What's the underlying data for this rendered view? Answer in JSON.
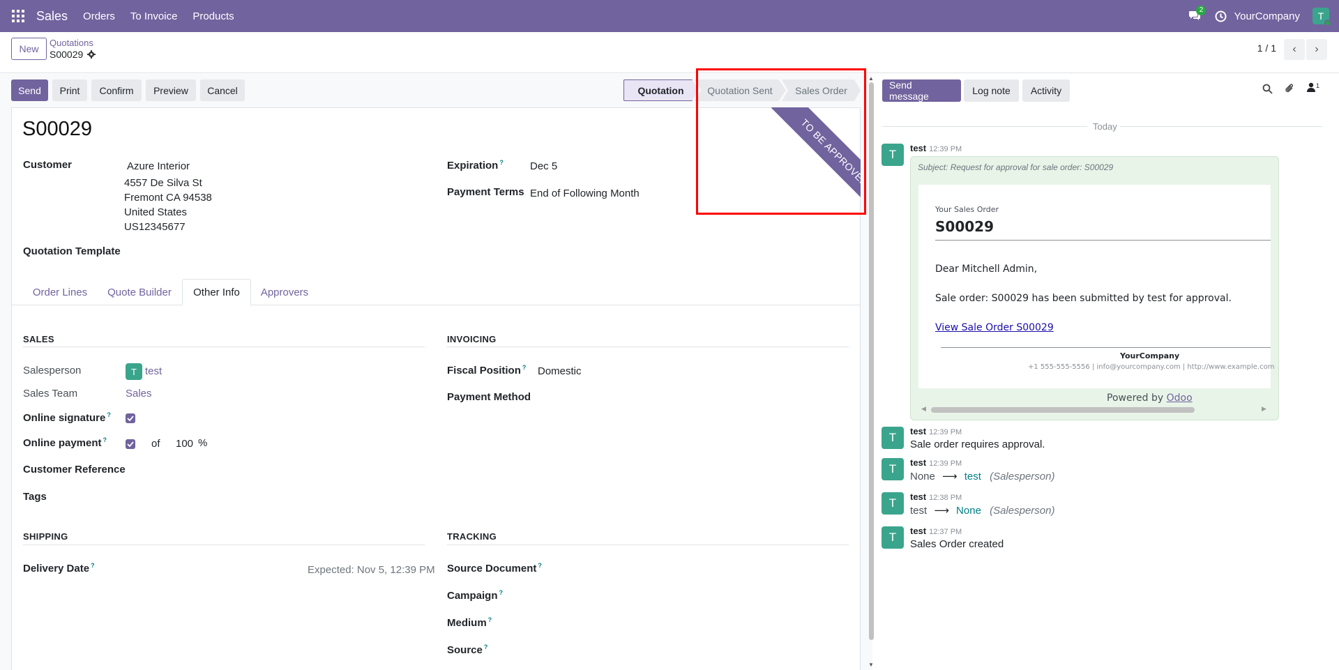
{
  "navbar": {
    "app_name": "Sales",
    "menus": [
      "Orders",
      "To Invoice",
      "Products"
    ],
    "chat_count": "2",
    "company": "YourCompany",
    "user_initial": "T",
    "bg_color": "#71639e"
  },
  "control_panel": {
    "new_label": "New",
    "breadcrumb_parent": "Quotations",
    "breadcrumb_current": "S00029",
    "pager": "1 / 1"
  },
  "actions": {
    "send": "Send",
    "print": "Print",
    "confirm": "Confirm",
    "preview": "Preview",
    "cancel": "Cancel"
  },
  "statusbar": {
    "stages": [
      "Quotation",
      "Quotation Sent",
      "Sales Order"
    ],
    "current": "Quotation"
  },
  "ribbon": "To Be Approved",
  "record": {
    "name": "S00029",
    "customer_label": "Customer",
    "customer": {
      "name": "Azure Interior",
      "street": "4557 De Silva St",
      "city": "Fremont CA 94538",
      "country": "United States",
      "vat": "US12345677"
    },
    "expiration_label": "Expiration",
    "expiration": "Dec 5",
    "payment_terms_label": "Payment Terms",
    "payment_terms": "End of Following Month",
    "quotation_template_label": "Quotation Template"
  },
  "tabs": [
    "Order Lines",
    "Quote Builder",
    "Other Info",
    "Approvers"
  ],
  "active_tab": "Other Info",
  "sales_section": {
    "title": "SALES",
    "salesperson_label": "Salesperson",
    "salesperson": "test",
    "salesperson_initial": "T",
    "sales_team_label": "Sales Team",
    "sales_team": "Sales",
    "online_signature_label": "Online signature",
    "online_signature": true,
    "online_payment_label": "Online payment",
    "online_payment": true,
    "of_label": "of",
    "prepayment_percent": "100",
    "percent_sign": "%",
    "customer_reference_label": "Customer Reference",
    "tags_label": "Tags"
  },
  "invoicing_section": {
    "title": "INVOICING",
    "fiscal_position_label": "Fiscal Position",
    "fiscal_position": "Domestic",
    "payment_method_label": "Payment Method"
  },
  "shipping_section": {
    "title": "SHIPPING",
    "delivery_date_label": "Delivery Date",
    "expected": "Expected: Nov 5, 12:39 PM"
  },
  "tracking_section": {
    "title": "TRACKING",
    "source_document_label": "Source Document",
    "campaign_label": "Campaign",
    "medium_label": "Medium",
    "source_label": "Source"
  },
  "help_mark": "?",
  "chatter": {
    "send_message": "Send message",
    "log_note": "Log note",
    "activity": "Activity",
    "followers_count": "1",
    "today": "Today",
    "email": {
      "author": "test",
      "time": "12:39 PM",
      "subject": "Subject: Request for approval for sale order: S00029",
      "small": "Your Sales Order",
      "big": "S00029",
      "greeting": "Dear Mitchell Admin,",
      "body": "Sale order: S00029 has been submitted by test for approval.",
      "link": "View Sale Order S00029",
      "company": "YourCompany",
      "contact": "+1 555-555-5556 | info@yourcompany.com | http://www.example.com",
      "powered_by": "Powered by",
      "powered_link": "Odoo"
    },
    "messages": [
      {
        "author": "test",
        "time": "12:39 PM",
        "body": "Sale order requires approval."
      },
      {
        "author": "test",
        "time": "12:39 PM",
        "old": "None",
        "new": "test",
        "field": "(Salesperson)"
      },
      {
        "author": "test",
        "time": "12:38 PM",
        "old": "test",
        "new": "None",
        "field": "(Salesperson)"
      },
      {
        "author": "test",
        "time": "12:37 PM",
        "body": "Sales Order created"
      }
    ],
    "avatar_initial": "T"
  }
}
